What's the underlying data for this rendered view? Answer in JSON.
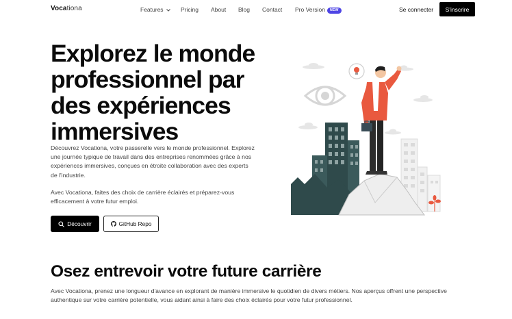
{
  "nav": {
    "brand_bold": "Voca",
    "brand_rest": "tiona",
    "items": [
      "Features",
      "Pricing",
      "About",
      "Blog",
      "Contact",
      "Pro Version"
    ],
    "badge": "NEW",
    "login": "Se connecter",
    "signup": "S'inscrire"
  },
  "hero": {
    "title": "Explorez le monde professionnel par des expériences immersives",
    "paragraph1": "Découvrez Vocationa, votre passerelle vers le monde professionnel. Explorez une journée typique de travail dans des entreprises renommées grâce à nos expériences immersives, conçues en étroite collaboration avec des experts de l'industrie.",
    "paragraph2": "Avec Vocationa, faites des choix de carrière éclairés et préparez-vous efficacement à votre futur emploi.",
    "primary_button": "Découvrir",
    "secondary_button": "GitHub Repo"
  },
  "section": {
    "title": "Osez entrevoir votre future carrière",
    "paragraph": "Avec Vocationa, prenez une longueur d'avance en explorant de manière immersive le quotidien de divers métiers. Nos aperçus offrent une perspective authentique sur votre carrière potentielle, vous aidant ainsi à faire des choix éclairés pour votre futur professionnel."
  },
  "icons": {
    "search": "search-icon",
    "github": "github-icon",
    "chevron": "chevron-down-icon",
    "illustration": "career-explorer-illustration"
  },
  "colors": {
    "accent": "#4f46e5",
    "primary": "#000000",
    "jacket": "#e9593f",
    "building": "#2f4a4b"
  }
}
